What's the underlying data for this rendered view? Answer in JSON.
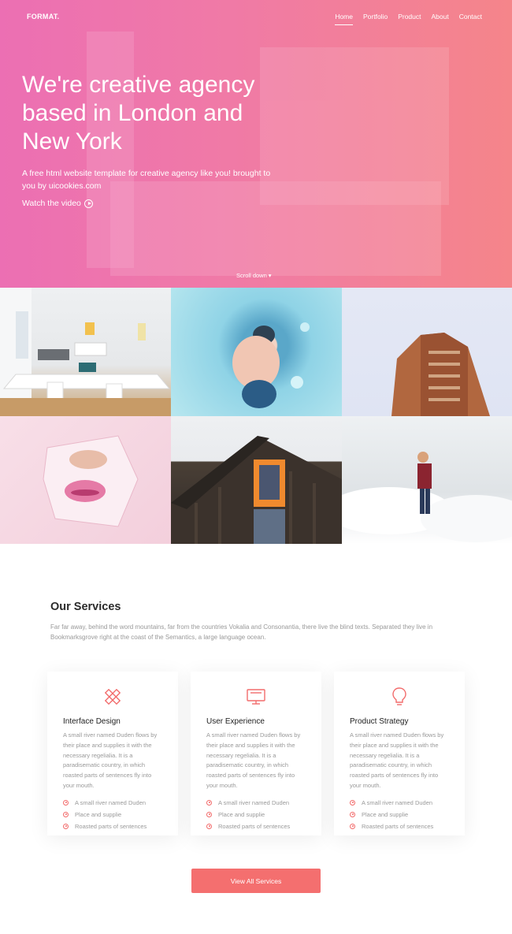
{
  "brand": {
    "logo": "FORMAT.",
    "accent": "#f46f6f"
  },
  "nav": {
    "items": [
      "Home",
      "Portfolio",
      "Product",
      "About",
      "Contact"
    ],
    "active": "Home"
  },
  "hero": {
    "title": "We're creative agency based in London and New York",
    "subtitle": "A free html website template for creative agency like you! brought to you by uicookies.com",
    "watch_label": "Watch the video",
    "scroll_label": "Scroll down"
  },
  "gallery": {
    "photos": [
      {
        "alt": "white office room"
      },
      {
        "alt": "person swimming"
      },
      {
        "alt": "brick building"
      },
      {
        "alt": "woman face torn paper"
      },
      {
        "alt": "wooden house with orange window"
      },
      {
        "alt": "man above clouds"
      }
    ]
  },
  "services": {
    "title": "Our Services",
    "description": "Far far away, behind the word mountains, far from the countries Vokalia and Consonantia, there live the blind texts. Separated they live in Bookmarksgrove right at the coast of the Semantics, a large language ocean.",
    "cards": [
      {
        "icon": "pencil-ruler-icon",
        "title": "Interface Design",
        "text": "A small river named Duden flows by their place and supplies it with the necessary regelialia. It is a paradisematic country, in which roasted parts of sentences fly into your mouth.",
        "items": [
          "A small river named Duden",
          "Place and supplie",
          "Roasted parts of sentences"
        ]
      },
      {
        "icon": "monitor-icon",
        "title": "User Experience",
        "text": "A small river named Duden flows by their place and supplies it with the necessary regelialia. It is a paradisematic country, in which roasted parts of sentences fly into your mouth.",
        "items": [
          "A small river named Duden",
          "Place and supplie",
          "Roasted parts of sentences"
        ]
      },
      {
        "icon": "lightbulb-icon",
        "title": "Product Strategy",
        "text": "A small river named Duden flows by their place and supplies it with the necessary regelialia. It is a paradisematic country, in which roasted parts of sentences fly into your mouth.",
        "items": [
          "A small river named Duden",
          "Place and supplie",
          "Roasted parts of sentences"
        ]
      }
    ],
    "button_label": "View All Services"
  }
}
